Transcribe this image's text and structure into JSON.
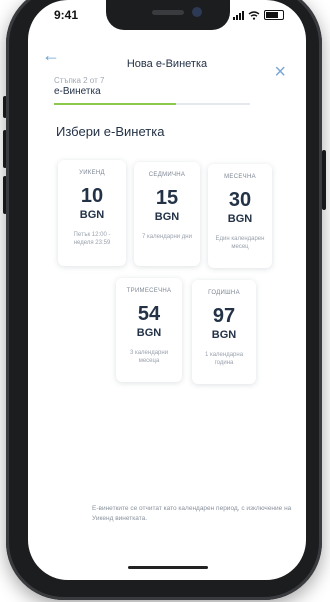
{
  "status_bar": {
    "time": "9:41"
  },
  "header": {
    "title": "Нова е-Винетка"
  },
  "step": {
    "counter": "Стъпка 2 от 7",
    "name": "е-Винетка",
    "progress": 0.62
  },
  "heading": "Избери е-Винетка",
  "vignettes": [
    {
      "period": "УИКЕНД",
      "price": "10",
      "currency": "BGN",
      "validity": "Петък 12:00 - неделя 23:59"
    },
    {
      "period": "СЕДМИЧНА",
      "price": "15",
      "currency": "BGN",
      "validity": "7 календарни дни"
    },
    {
      "period": "МЕСЕЧНА",
      "price": "30",
      "currency": "BGN",
      "validity": "Един календарен месец"
    },
    {
      "period": "ТРИМЕСЕЧНА",
      "price": "54",
      "currency": "BGN",
      "validity": "3 календарни месеца"
    },
    {
      "period": "ГОДИШНА",
      "price": "97",
      "currency": "BGN",
      "validity": "1 календарна година"
    }
  ],
  "footer_note": "Е-винетките се отчитат като календарен период, с изключение на Уикенд винетката."
}
